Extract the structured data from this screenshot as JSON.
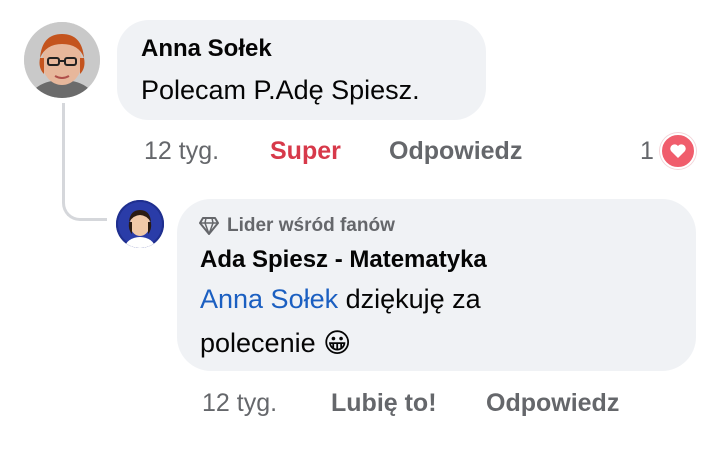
{
  "comment": {
    "author": "Anna Sołek",
    "text": "Polecam P.Adę Spiesz.",
    "time": "12 tyg.",
    "reaction_label": "Super",
    "reply_label": "Odpowiedz",
    "reaction_count": "1",
    "reaction_icon": "heart-icon",
    "reaction_color": "#d7394a"
  },
  "reply": {
    "badge": "Lider wśród fanów",
    "badge_icon": "diamond-icon",
    "author": "Ada Spiesz - Matematyka",
    "mention": "Anna Sołek",
    "text_line1_rest": " dziękuję za",
    "text_line2": "polecenie ",
    "emoji": "😀",
    "time": "12 tyg.",
    "like_label": "Lubię to!",
    "reply_label": "Odpowiedz",
    "mention_color": "#1b5fc1"
  }
}
